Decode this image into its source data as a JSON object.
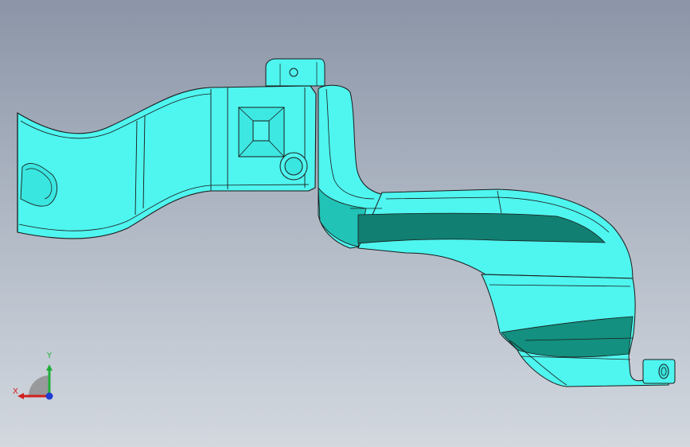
{
  "viewport": {
    "background_top": "#8b95a7",
    "background_bottom": "#d3d8df",
    "part_color": "#48f4ee",
    "part_shade_color": "#0e8b7c",
    "edge_color": "#1a1a1a"
  },
  "triad": {
    "x_label": "X",
    "y_label": "Y",
    "x_color": "#d11f1f",
    "y_color": "#1fae3a",
    "z_color": "#1f3bd1"
  }
}
